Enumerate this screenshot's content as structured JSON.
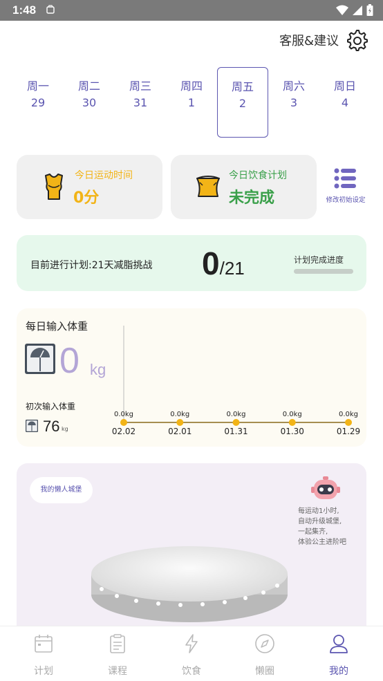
{
  "status_bar": {
    "time": "1:48"
  },
  "header": {
    "support_label": "客服&建议"
  },
  "week": [
    {
      "name": "周一",
      "date": "29"
    },
    {
      "name": "周二",
      "date": "30"
    },
    {
      "name": "周三",
      "date": "31"
    },
    {
      "name": "周四",
      "date": "1"
    },
    {
      "name": "周五",
      "date": "2",
      "selected": true
    },
    {
      "name": "周六",
      "date": "3"
    },
    {
      "name": "周日",
      "date": "4"
    }
  ],
  "exercise_card": {
    "title": "今日运动时间",
    "value": "0分"
  },
  "diet_card": {
    "title": "今日饮食计划",
    "value": "未完成"
  },
  "modify_settings": {
    "label": "修改初始设定"
  },
  "plan": {
    "current_plan": "目前进行计划:21天减脂挑战",
    "done": "0",
    "total": "/21",
    "progress_label": "计划完成进度",
    "progress": 0
  },
  "weight": {
    "title": "每日输入体重",
    "value": "0",
    "unit": "kg",
    "initial_label": "初次输入体重",
    "initial_value": "76",
    "initial_unit": "kg"
  },
  "chart_data": {
    "type": "line",
    "categories": [
      "02.02",
      "02.01",
      "01.31",
      "01.30",
      "01.29"
    ],
    "values": [
      0.0,
      0.0,
      0.0,
      0.0,
      0.0
    ],
    "point_labels": [
      "0.0kg",
      "0.0kg",
      "0.0kg",
      "0.0kg",
      "0.0kg"
    ],
    "color": "#f2b417",
    "line_color": "#8a6a1a"
  },
  "castle": {
    "pill_label": "我的懒人城堡",
    "hint_lines": [
      "每运动1小时,",
      "自动升级城堡,",
      "一起集齐,",
      "体验公主进阶吧"
    ]
  },
  "tabs": [
    {
      "label": "计划",
      "icon": "calendar-icon"
    },
    {
      "label": "课程",
      "icon": "clipboard-icon"
    },
    {
      "label": "饮食",
      "icon": "lightning-icon"
    },
    {
      "label": "懒圈",
      "icon": "compass-icon"
    },
    {
      "label": "我的",
      "icon": "person-icon",
      "active": true
    }
  ],
  "colors": {
    "accent": "#5b55b0",
    "yellow": "#f2b417",
    "green": "#3aa04a",
    "plan_bg": "#e6f8ec"
  }
}
